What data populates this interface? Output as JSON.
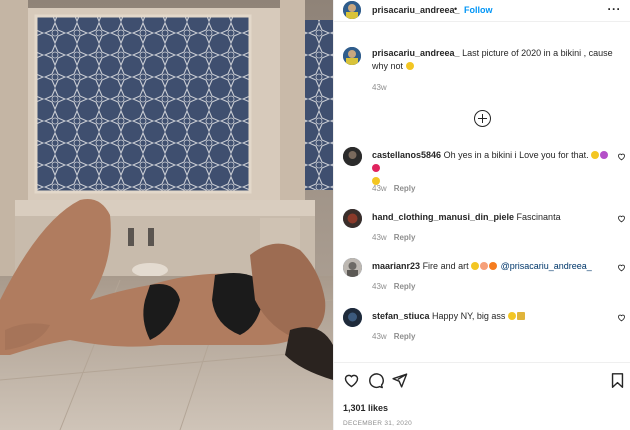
{
  "post": {
    "username": "prisacariu_andreea_",
    "dot": "•",
    "follow_label": "Follow",
    "more_label": "···"
  },
  "caption": {
    "username": "prisacariu_andreea_",
    "text": "Last picture of 2020 in a bikini , cause why not",
    "time": "43w"
  },
  "comments": [
    {
      "username": "castellanos5846",
      "text": "Oh yes in a bikini i Love you for that.",
      "time": "43w",
      "reply_label": "Reply",
      "avatar_color": "#2b2b2b"
    },
    {
      "username": "hand_clothing_manusi_din_piele",
      "text": "Fascinanta",
      "time": "43w",
      "reply_label": "Reply",
      "avatar_color": "#3a2e2a"
    },
    {
      "username": "maarianr23",
      "text": "Fire and art",
      "mention": "@prisacariu_andreea_",
      "time": "43w",
      "reply_label": "Reply",
      "avatar_color": "#6d6a66"
    },
    {
      "username": "stefan_stiuca",
      "text": "Happy NY, big ass",
      "time": "43w",
      "reply_label": "Reply",
      "avatar_color": "#1e2a3a"
    }
  ],
  "footer": {
    "likes": "1,301 likes",
    "date": "DECEMBER 31, 2020"
  },
  "icons": {
    "like": "heart-icon",
    "comment": "comment-icon",
    "share": "paper-plane-icon",
    "save": "bookmark-icon",
    "load_more": "plus-circle-icon"
  },
  "colors": {
    "follow": "#0095f6",
    "mention": "#00376b",
    "muted": "#8e8e8e",
    "text": "#262626"
  }
}
